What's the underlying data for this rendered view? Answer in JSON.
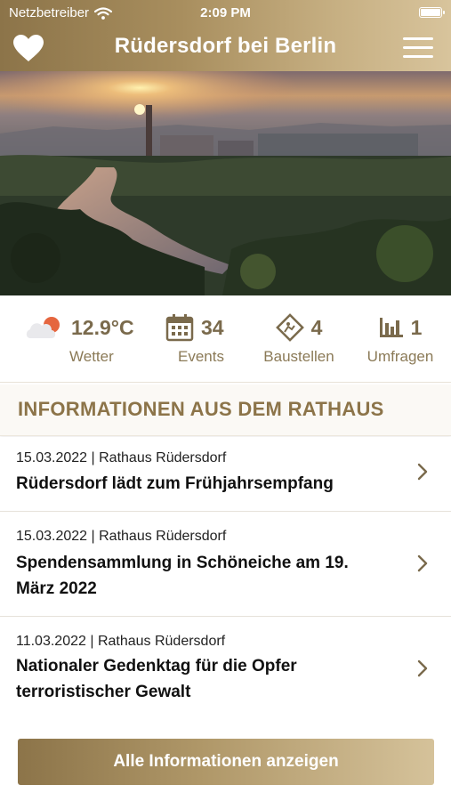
{
  "status_bar": {
    "carrier": "Netzbetreiber",
    "time": "2:09 PM"
  },
  "header": {
    "title": "Rüdersdorf bei Berlin"
  },
  "stats": {
    "weather": {
      "value": "12.9°C",
      "label": "Wetter"
    },
    "events": {
      "value": "34",
      "label": "Events"
    },
    "construction": {
      "value": "4",
      "label": "Baustellen"
    },
    "surveys": {
      "value": "1",
      "label": "Umfragen"
    }
  },
  "section": {
    "title": "INFORMATIONEN AUS DEM RATHAUS"
  },
  "news": [
    {
      "meta": "15.03.2022 | Rathaus Rüdersdorf",
      "headline_line1": "Rüdersdorf lädt zum Frühjahrsempfang",
      "headline_line2": ""
    },
    {
      "meta": "15.03.2022 | Rathaus Rüdersdorf",
      "headline_line1": "Spendensammlung in Schöneiche am 19.",
      "headline_line2": "März 2022"
    },
    {
      "meta": "11.03.2022 | Rathaus Rüdersdorf",
      "headline_line1": "Nationaler Gedenktag für die Opfer",
      "headline_line2": "terroristischer Gewalt"
    }
  ],
  "cta": {
    "label": "Alle Informationen anzeigen"
  },
  "colors": {
    "brand_gold": "#8c7449",
    "brand_gold_light": "#d5c29a",
    "text_dark": "#111111"
  }
}
